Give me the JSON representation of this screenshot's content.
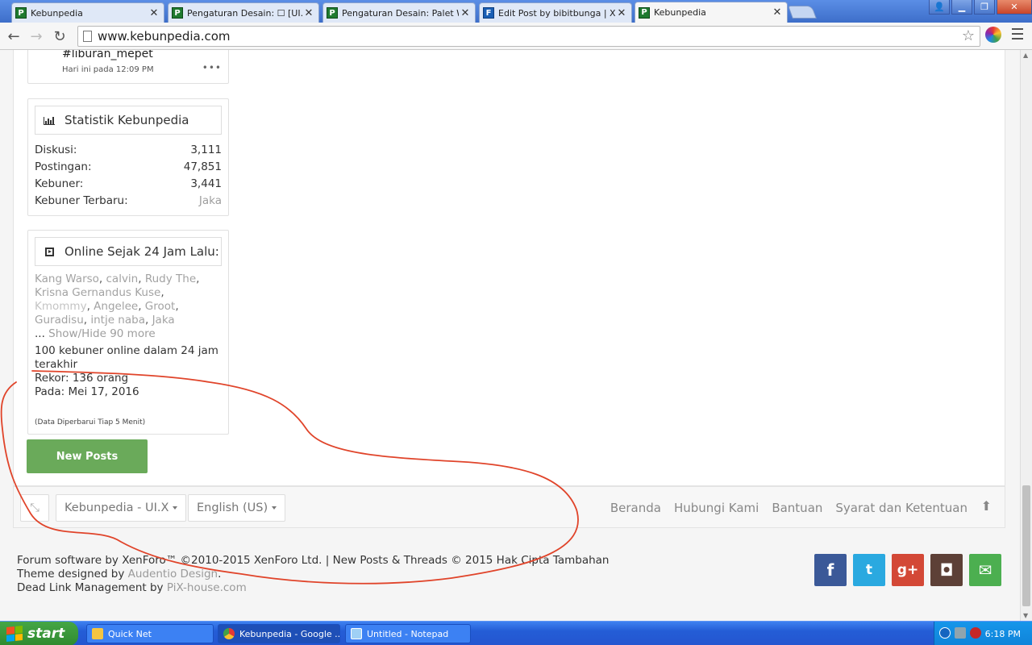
{
  "browser": {
    "tabs": [
      {
        "label": "Kebunpedia",
        "icon": "kebunpedia-favicon",
        "active": false
      },
      {
        "label": "Pengaturan Desain: ☐ [UI.X",
        "icon": "kebunpedia-favicon",
        "active": false
      },
      {
        "label": "Pengaturan Desain: Palet Wa",
        "icon": "kebunpedia-favicon",
        "active": false
      },
      {
        "label": "Edit Post by bibitbunga | Xen",
        "icon": "xenforo-favicon",
        "active": false
      },
      {
        "label": "Kebunpedia",
        "icon": "kebunpedia-favicon",
        "active": true
      }
    ],
    "url": "www.kebunpedia.com"
  },
  "sidebar": {
    "recent": {
      "tag": "#liburan_mepet",
      "time": "Hari ini pada 12:09 PM",
      "more": "•••"
    },
    "stats": {
      "title": "Statistik Kebunpedia",
      "rows": [
        {
          "label": "Diskusi:",
          "value": "3,111"
        },
        {
          "label": "Postingan:",
          "value": "47,851"
        },
        {
          "label": "Kebuner:",
          "value": "3,441"
        },
        {
          "label": "Kebuner Terbaru:",
          "value": "Jaka"
        }
      ]
    },
    "online": {
      "title": "Online Sejak 24 Jam Lalu:",
      "names": [
        "Kang Warso",
        "calvin",
        "Rudy The",
        "Krisna Gernandus Kuse",
        "Kmommy",
        "Angelee",
        "Groot",
        "Guradisu",
        "intje naba",
        "Jaka"
      ],
      "more_prefix": "...",
      "more_link": "Show/Hide 90 more",
      "count_text": "100 kebuner online dalam 24 jam terakhir",
      "record_text": "Rekor: 136 orang",
      "date_text": "Pada: Mei 17, 2016",
      "updated_text": "(Data Diperbarui Tiap 5 Menit)"
    },
    "new_posts_label": "New Posts"
  },
  "footer": {
    "style_chooser": "Kebunpedia - UI.X",
    "language_chooser": "English (US)",
    "links": [
      "Beranda",
      "Hubungi Kami",
      "Bantuan",
      "Syarat dan Ketentuan"
    ],
    "copyright_line1": "Forum software by XenForo™ ©2010-2015 XenForo Ltd. | New Posts & Threads © 2015 Hak Cipta Tambahan",
    "theme_prefix": "Theme designed by ",
    "theme_link": "Audentio Design",
    "theme_suffix": ".",
    "deadlink_prefix": "Dead Link Management by ",
    "deadlink_link": "PiX-house.com",
    "social": [
      {
        "name": "facebook",
        "glyph": "f",
        "color": "#3b5998"
      },
      {
        "name": "twitter",
        "glyph": "t",
        "color": "#2aa9e0"
      },
      {
        "name": "google-plus",
        "glyph": "g+",
        "color": "#d34836"
      },
      {
        "name": "instagram",
        "glyph": "◘",
        "color": "#5d4037"
      },
      {
        "name": "email",
        "glyph": "✉",
        "color": "#4caf50"
      }
    ]
  },
  "taskbar": {
    "start_label": "start",
    "tasks": [
      {
        "label": "Quick Net",
        "active": false
      },
      {
        "label": "Kebunpedia - Google ...",
        "active": true
      },
      {
        "label": "Untitled - Notepad",
        "active": false
      }
    ],
    "clock": "6:18 PM"
  },
  "colors": {
    "accent_green": "#6aaa5a",
    "annotation_red": "#e0442a",
    "xp_blue": "#245dd6"
  }
}
